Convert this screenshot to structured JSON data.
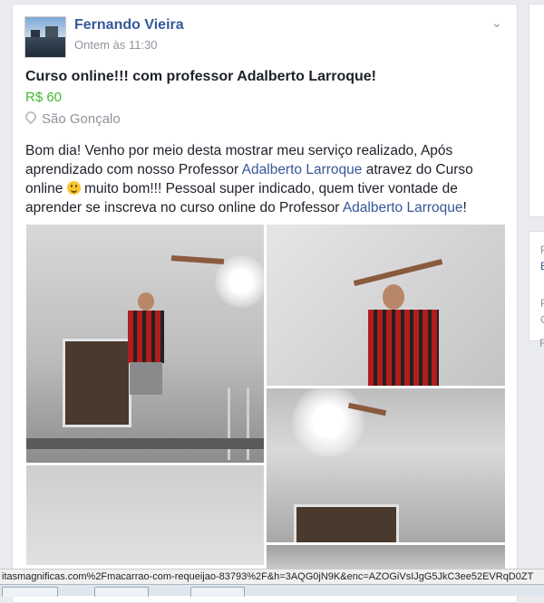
{
  "post": {
    "author": "Fernando Vieira",
    "timestamp": "Ontem às 11:30",
    "title": "Curso online!!! com professor Adalberto Larroque!",
    "price": "R$ 60",
    "location": "São Gonçalo",
    "text_1": "Bom dia! Venho por meio desta mostrar meu serviço realizado, Após aprendizado com nosso Professor ",
    "mention_1": "Adalberto Larroque",
    "text_2": " atravez do Curso online ",
    "text_3": " muito bom!!! Pessoal super indicado, quem tiver vontade de aprender se inscreva no curso online do Professor ",
    "mention_2": "Adalberto Larroque",
    "text_4": "!"
  },
  "sidebar": {
    "line1": "P",
    "line2": "E",
    "line3": "P",
    "line4": "C",
    "line5": "F"
  },
  "statusbar": {
    "url": "itasmagnificas.com%2Fmacarrao-com-requeijao-83793%2F&h=3AQG0jN9K&enc=AZOGiVsIJgG5JkC3ee52EVRqD0ZT"
  },
  "icons": {
    "chevron": "chevron-down-icon",
    "location": "location-pin-icon",
    "emoji": "smiley-emoji-icon"
  },
  "colors": {
    "name_link": "#365899",
    "price": "#42b72a",
    "meta": "#90949c"
  }
}
